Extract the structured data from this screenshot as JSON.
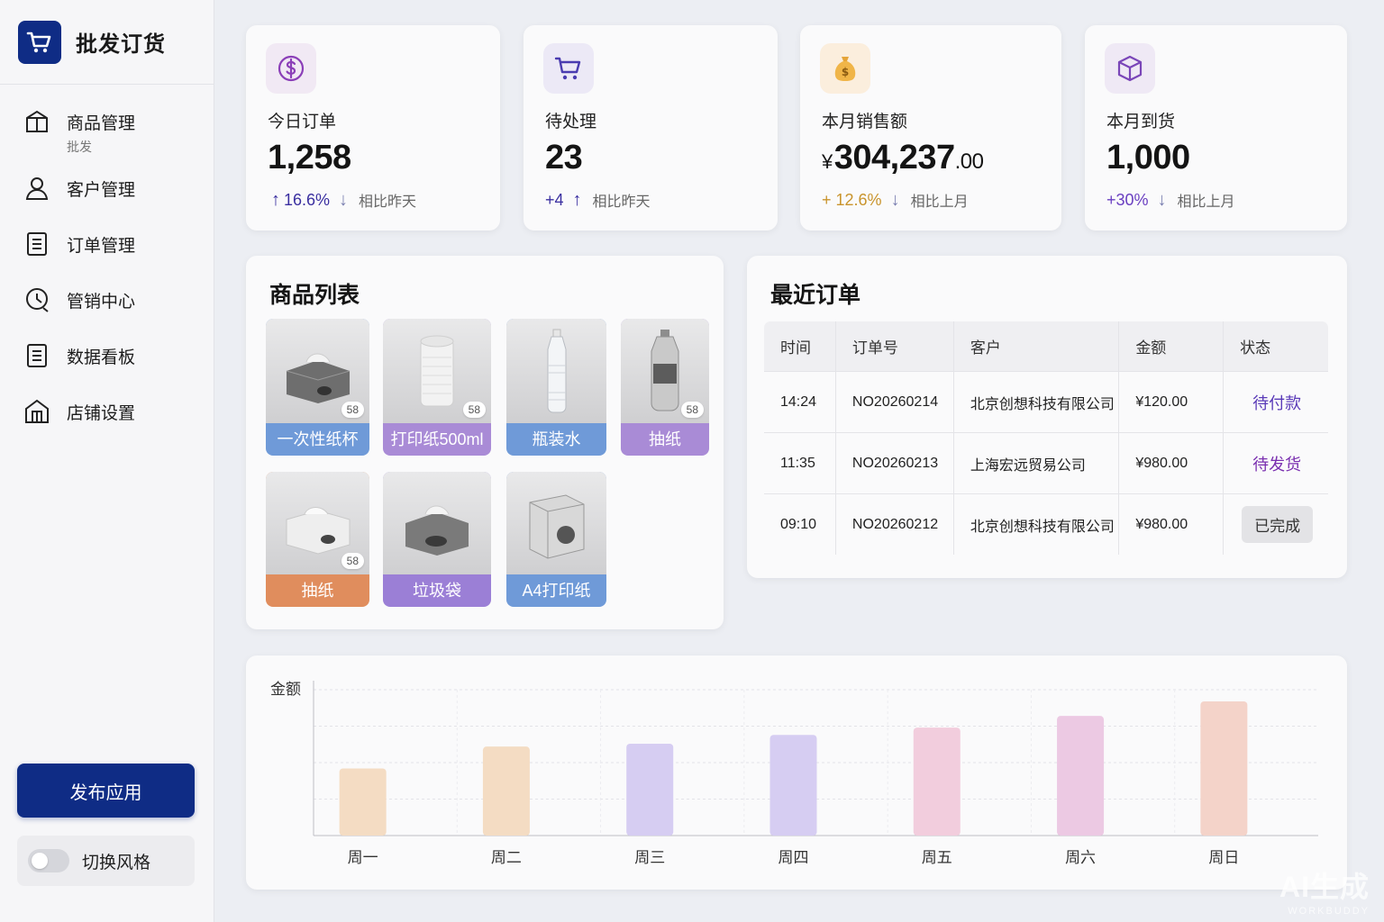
{
  "brand": {
    "title": "批发订货"
  },
  "sidebar": {
    "items": [
      {
        "label": "商品管理",
        "sub": "批发",
        "icon": "box-icon"
      },
      {
        "label": "客户管理",
        "icon": "user-icon"
      },
      {
        "label": "订单管理",
        "icon": "document-icon"
      },
      {
        "label": "管销中心",
        "icon": "marketing-icon"
      },
      {
        "label": "数据看板",
        "icon": "dashboard-icon"
      },
      {
        "label": "店铺设置",
        "icon": "store-icon"
      }
    ],
    "publish_label": "发布应用",
    "toggle_label": "切换风格"
  },
  "stats": [
    {
      "label": "今日订单",
      "value": "1,258",
      "change": "16.6%",
      "compare": "相比昨天",
      "icon": "dollar-icon"
    },
    {
      "label": "待处理",
      "value": "23",
      "change": "+4",
      "compare": "相比昨天",
      "icon": "cart-icon"
    },
    {
      "label": "本月销售额",
      "currency": "¥",
      "value": "304,237",
      "decimal": ".00",
      "change": "+ 12.6%",
      "compare": "相比上月",
      "icon": "money-bag-icon"
    },
    {
      "label": "本月到货",
      "value": "1,000",
      "change": "+30%",
      "compare": "相比上月",
      "icon": "package-icon"
    }
  ],
  "products": {
    "title": "商品列表",
    "items": [
      {
        "name": "一次性纸杯",
        "badge": "58",
        "color": "#6f9ad8"
      },
      {
        "name": "打印纸500ml",
        "badge": "58",
        "color": "#a98bd6"
      },
      {
        "name": "瓶装水",
        "badge": "",
        "color": "#6f9ad8"
      },
      {
        "name": "抽纸",
        "badge": "58",
        "color": "#a98bd6"
      },
      {
        "name": "抽纸",
        "badge": "58",
        "color": "#e08d5d"
      },
      {
        "name": "垃圾袋",
        "badge": "",
        "color": "#9b7fd6"
      },
      {
        "name": "A4打印纸",
        "badge": "",
        "color": "#6f9ad8"
      }
    ]
  },
  "orders": {
    "title": "最近订单",
    "headers": [
      "时间",
      "订单号",
      "客户",
      "金额",
      "状态"
    ],
    "rows": [
      {
        "time": "14:24",
        "no": "NO20260214",
        "customer": "北京创想科技有限公司",
        "amount": "¥120.00",
        "status": "待付款"
      },
      {
        "time": "11:35",
        "no": "NO20260213",
        "customer": "上海宏远贸易公司",
        "amount": "¥980.00",
        "status": "待发货"
      },
      {
        "time": "09:10",
        "no": "NO20260212",
        "customer": "北京创想科技有限公司",
        "amount": "¥980.00",
        "status": "已完成"
      }
    ]
  },
  "colors": {
    "brand": "#0f2c85",
    "up": "#3a2fa0",
    "gold": "#c9942c",
    "purple": "#6a3fc1"
  },
  "chart_data": {
    "type": "bar",
    "ylabel": "金额",
    "categories": [
      "周一",
      "周二",
      "周三",
      "周四",
      "周五",
      "周六",
      "周日"
    ],
    "values": [
      46,
      61,
      63,
      69,
      74,
      82,
      92
    ],
    "ylim": [
      0,
      100
    ],
    "colors": [
      "#f4dcc3",
      "#f4dcc3",
      "#d6cdf2",
      "#d6cdf2",
      "#f2cddd",
      "#ecc9e3",
      "#f4d3c9"
    ],
    "grid": true
  },
  "watermark": {
    "line1": "AI生成",
    "line2": "WORKBUDDY"
  }
}
